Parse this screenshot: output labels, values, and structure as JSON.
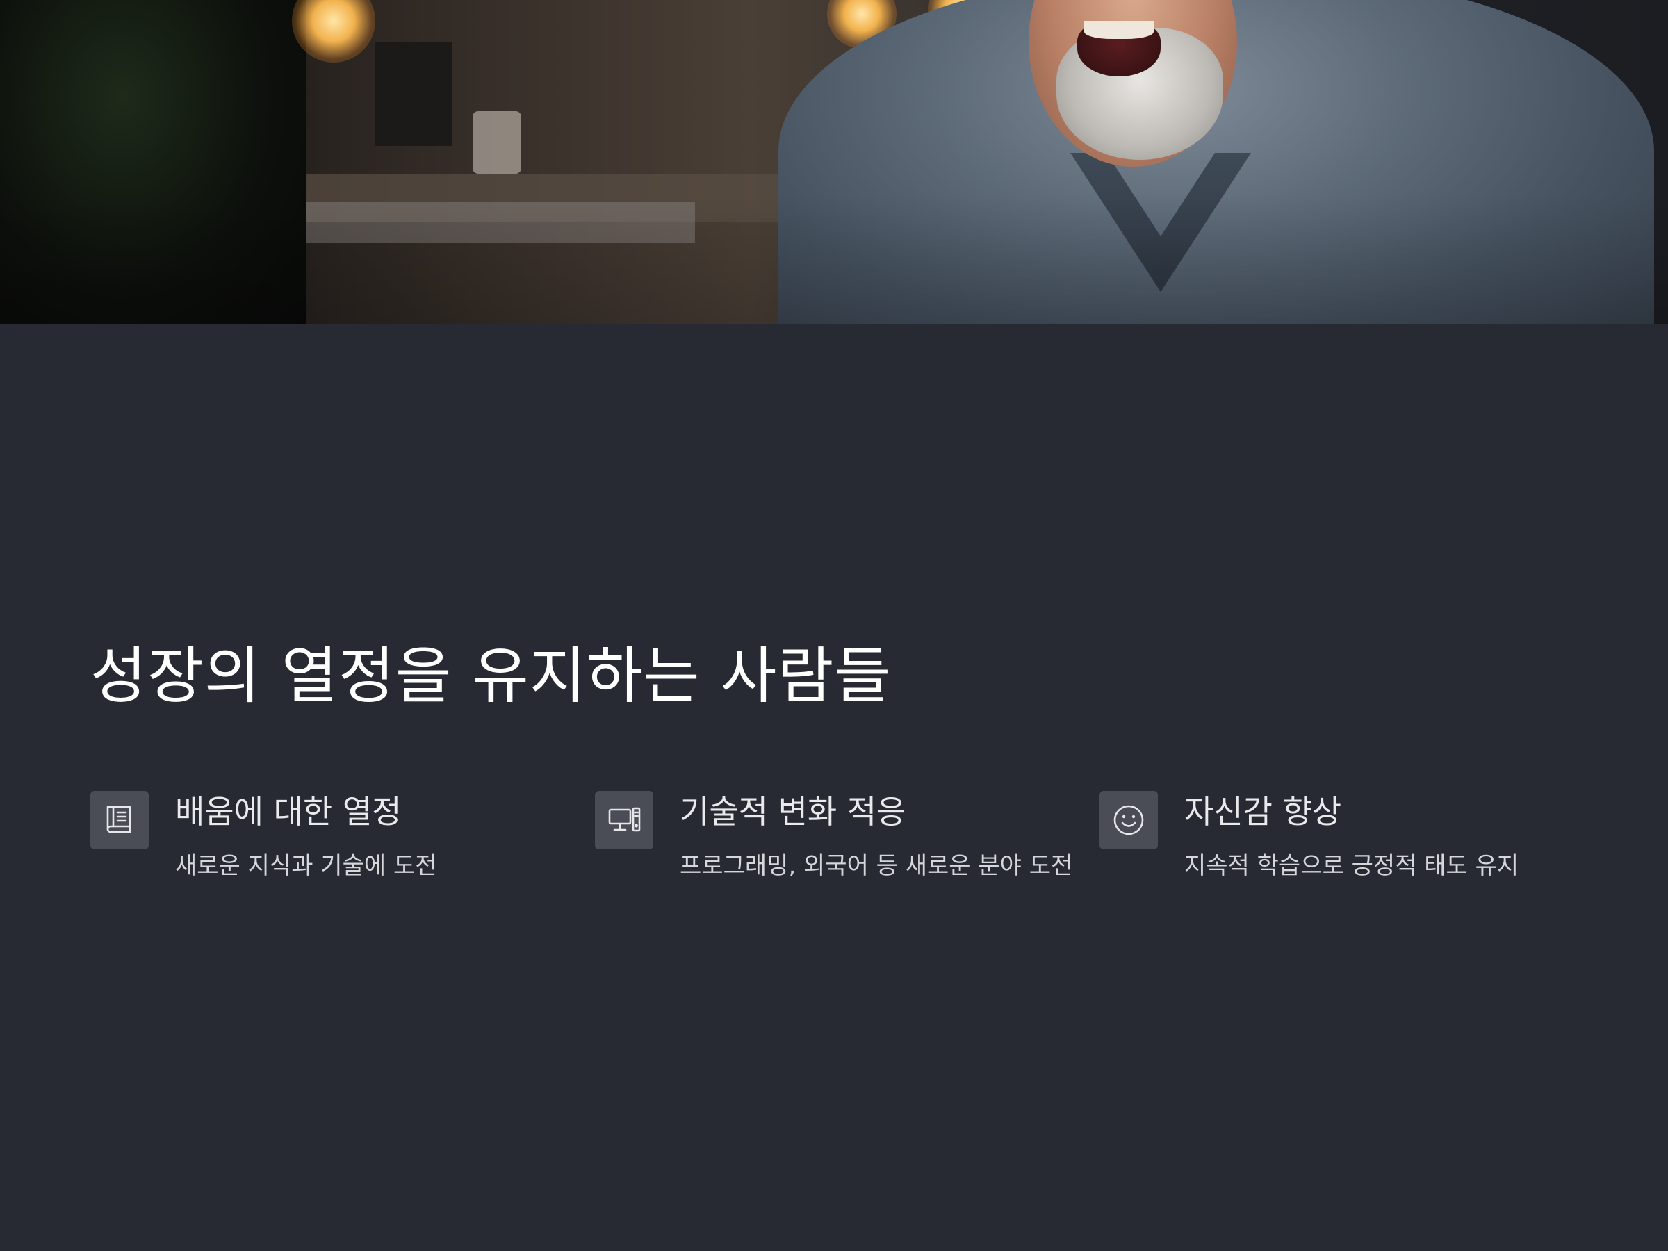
{
  "hero": {
    "image_description": "Photo of a smiling elderly man with a white beard wearing a blue checked shirt, warm bokeh lights in background"
  },
  "main": {
    "title": "성장의 열정을 유지하는 사람들"
  },
  "features": [
    {
      "icon": "book-icon",
      "title": "배움에 대한 열정",
      "description": "새로운 지식과 기술에 도전"
    },
    {
      "icon": "computer-icon",
      "title": "기술적 변화 적응",
      "description": "프로그래밍, 외국어 등 새로운 분야 도전"
    },
    {
      "icon": "smile-icon",
      "title": "자신감 향상",
      "description": "지속적 학습으로 긍정적 태도 유지"
    }
  ],
  "colors": {
    "background": "#272a33",
    "icon_box": "#4a4d55",
    "title_text": "#ffffff",
    "body_text": "#d5d7db"
  }
}
